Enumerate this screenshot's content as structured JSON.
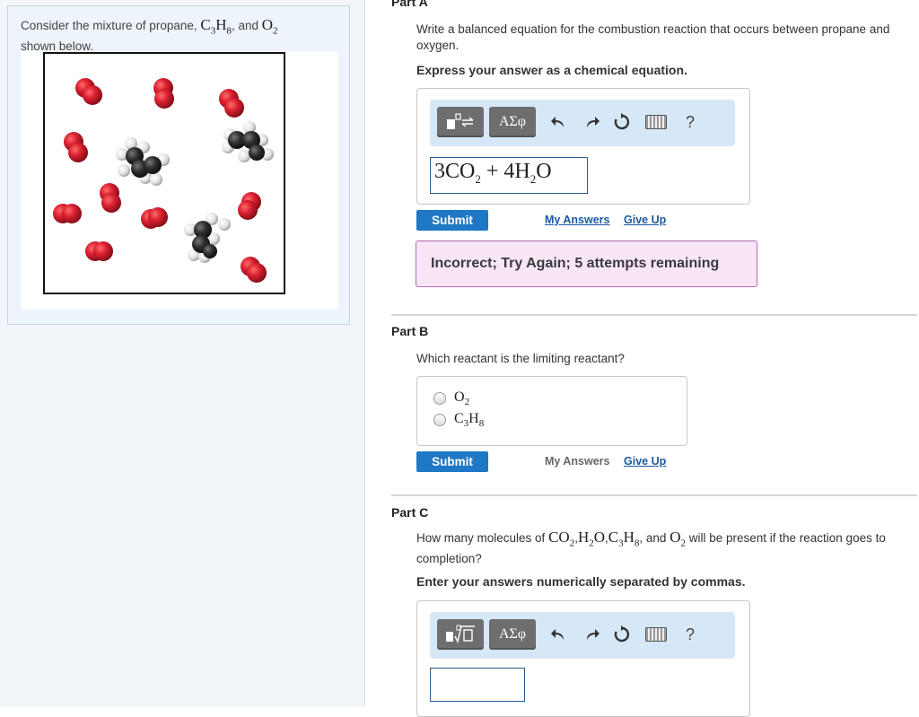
{
  "problem": {
    "intro_1": "Consider the mixture of propane, ",
    "propane_C": "C",
    "propane_c_sub": "3",
    "propane_H": "H",
    "propane_h_sub": "8",
    "intro_and": ", and ",
    "oxygen_O": "O",
    "oxygen_sub": "2",
    "intro_2": "shown below."
  },
  "part_a": {
    "title": "Part A",
    "question": "Write a balanced equation for the combustion reaction that occurs between propane and oxygen.",
    "instruction": "Express your answer as a chemical equation.",
    "toolbar": {
      "template_icon": "template-icon",
      "greek_label": "ΑΣφ",
      "help_label": "?"
    },
    "answer": {
      "coef1": "3CO",
      "sub1": "2",
      "plus": " + 4H",
      "sub2": "2",
      "tail": "O"
    },
    "submit_label": "Submit",
    "my_answers_label": "My Answers",
    "give_up_label": "Give Up",
    "feedback": "Incorrect; Try Again; 5 attempts remaining"
  },
  "part_b": {
    "title": "Part B",
    "question": "Which reactant is the limiting reactant?",
    "options": [
      {
        "main": "O",
        "sub": "2",
        "main2": "",
        "sub2": ""
      },
      {
        "main": "C",
        "sub": "3",
        "main2": "H",
        "sub2": "8"
      }
    ],
    "submit_label": "Submit",
    "my_answers_label": "My Answers",
    "give_up_label": "Give Up"
  },
  "part_c": {
    "title": "Part C",
    "question_1": "How many molecules of ",
    "q_f1": "CO",
    "q_s1": "2",
    "q_comma1": ",",
    "q_f2": "H",
    "q_s2": "2",
    "q_f2b": "O",
    "q_comma2": ",",
    "q_f3": "C",
    "q_s3": "3",
    "q_f3b": "H",
    "q_s3b": "8",
    "q_and": ", and ",
    "q_f4": "O",
    "q_s4": "2",
    "question_2": " will be present if the reaction goes to completion?",
    "instruction": "Enter your answers numerically separated by commas.",
    "toolbar": {
      "greek_label": "ΑΣφ",
      "help_label": "?"
    }
  },
  "colors": {
    "oxygen": "#cc1f2e",
    "carbon": "#2b2b2b",
    "hydrogen": "#e6e6e6",
    "submit": "#1f78c5",
    "feedback_bg": "#f8e6f7",
    "feedback_border": "#b367b4",
    "toolbar_bg": "#d6e7f7"
  }
}
